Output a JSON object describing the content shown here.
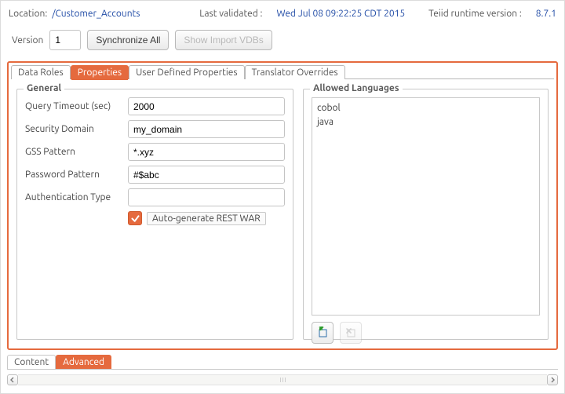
{
  "header": {
    "location_label": "Location:",
    "location_path": "/Customer_Accounts",
    "last_validated_label": "Last validated :",
    "last_validated_value": "Wed Jul 08 09:22:25 CDT 2015",
    "runtime_label": "Teiid runtime version :",
    "runtime_value": "8.7.1"
  },
  "row2": {
    "version_label": "Version",
    "version_value": "1",
    "sync_label": "Synchronize All",
    "show_import_label": "Show Import VDBs"
  },
  "tabs": [
    {
      "label": "Data Roles",
      "active": false
    },
    {
      "label": "Properties",
      "active": true
    },
    {
      "label": "User Defined Properties",
      "active": false
    },
    {
      "label": "Translator Overrides",
      "active": false
    }
  ],
  "general": {
    "legend": "General",
    "fields": {
      "query_timeout_label": "Query Timeout (sec)",
      "query_timeout_value": "2000",
      "security_domain_label": "Security Domain",
      "security_domain_value": "my_domain",
      "gss_pattern_label": "GSS Pattern",
      "gss_pattern_value": "*.xyz",
      "password_pattern_label": "Password Pattern",
      "password_pattern_value": "#$abc",
      "auth_type_label": "Authentication Type",
      "auth_type_value": ""
    },
    "autogen_label": "Auto-generate REST WAR",
    "autogen_checked": true
  },
  "allowed": {
    "legend": "Allowed Languages",
    "items": [
      "cobol",
      "java"
    ]
  },
  "bottom_tabs": [
    {
      "label": "Content",
      "active": false
    },
    {
      "label": "Advanced",
      "active": true
    }
  ]
}
